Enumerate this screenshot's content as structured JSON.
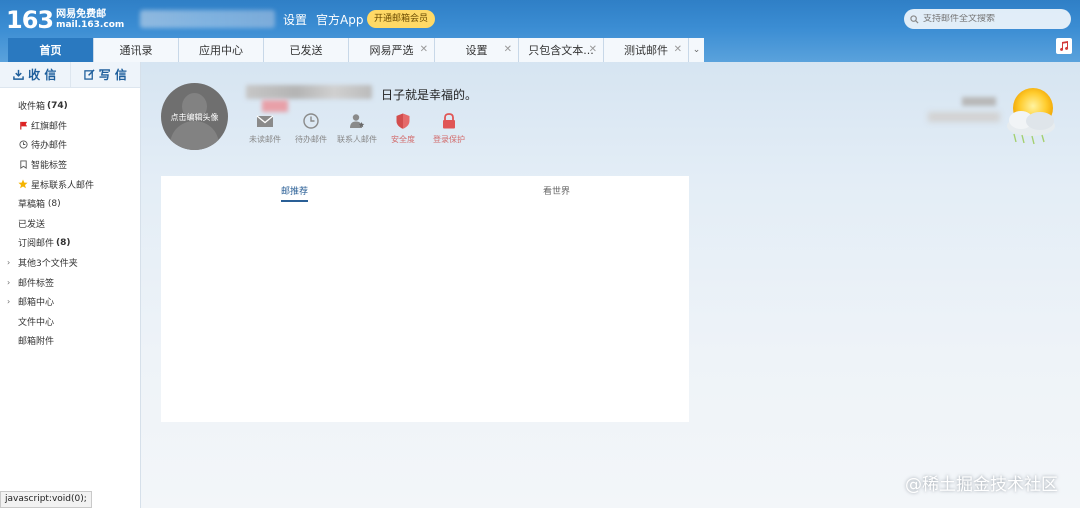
{
  "header": {
    "logo_number": "163",
    "logo_cn": "网易免费邮",
    "logo_domain": "mail.163.com",
    "settings_link": "设置",
    "app_link": "官方App",
    "vip_button": "开通邮箱会员",
    "search_placeholder": "支持邮件全文搜索"
  },
  "tabs": [
    {
      "label": "首页",
      "active": true,
      "closable": false
    },
    {
      "label": "通讯录",
      "active": false,
      "closable": false
    },
    {
      "label": "应用中心",
      "active": false,
      "closable": false
    },
    {
      "label": "已发送",
      "active": false,
      "closable": false
    },
    {
      "label": "网易严选",
      "active": false,
      "closable": true
    },
    {
      "label": "设置",
      "active": false,
      "closable": true
    },
    {
      "label": "只包含文本...",
      "active": false,
      "closable": true
    },
    {
      "label": "测试邮件",
      "active": false,
      "closable": true
    }
  ],
  "sidebar": {
    "receive_label": "收 信",
    "compose_label": "写 信",
    "folders": [
      {
        "label": "收件箱",
        "count": "(74)"
      },
      {
        "label": "红旗邮件",
        "icon": "red-flag-icon"
      },
      {
        "label": "待办邮件",
        "icon": "clock-icon"
      },
      {
        "label": "智能标签",
        "icon": "bookmark-icon"
      },
      {
        "label": "星标联系人邮件",
        "icon": "star-icon"
      },
      {
        "label": "草稿箱",
        "count_plain": "(8)"
      },
      {
        "label": "已发送"
      },
      {
        "label": "订阅邮件",
        "count": "(8)"
      },
      {
        "label": "其他3个文件夹",
        "expand": true
      },
      {
        "label": "邮件标签",
        "expand": true
      },
      {
        "label": "邮箱中心",
        "expand": true
      },
      {
        "label": "文件中心"
      },
      {
        "label": "邮箱附件"
      }
    ]
  },
  "profile": {
    "avatar_label": "点击编辑头像",
    "motto": "日子就是幸福的。",
    "quick": [
      {
        "label": "未读邮件",
        "icon": "envelope-icon"
      },
      {
        "label": "待办邮件",
        "icon": "clock-icon"
      },
      {
        "label": "联系人邮件",
        "icon": "contact-icon"
      },
      {
        "label": "安全度",
        "icon": "shield-icon"
      },
      {
        "label": "登录保护",
        "icon": "lock-icon"
      }
    ]
  },
  "panel": {
    "tab_recommend": "邮推荐",
    "tab_world": "看世界"
  },
  "status_text": "javascript:void(0);",
  "watermark": "@稀土掘金技术社区",
  "colors": {
    "header_blue": "#3b8dd3",
    "active_tab": "#2a79c0",
    "vip_yellow": "#ffd966",
    "accent_red": "#d26a6a"
  }
}
